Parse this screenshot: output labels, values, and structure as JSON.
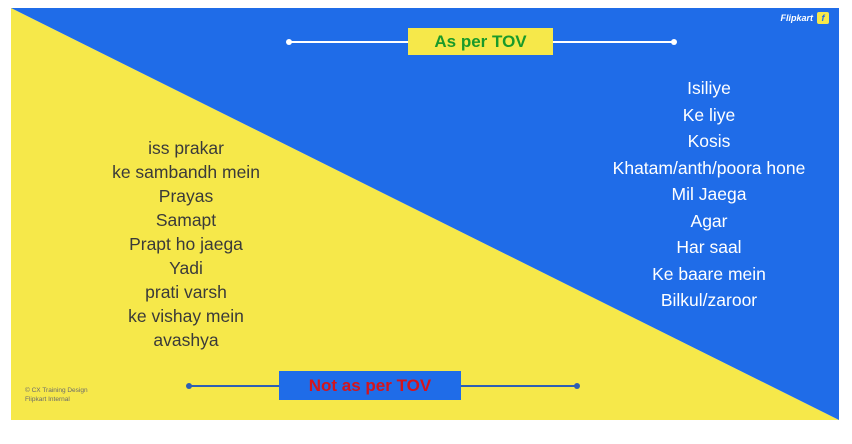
{
  "colors": {
    "blue": "#1f6ce8",
    "yellow": "#f6e84a",
    "green_text": "#1a9a2a",
    "red_text": "#d4141c"
  },
  "logo": {
    "text": "Flipkart",
    "icon": "flipkart-bag-icon",
    "glyph": "f"
  },
  "top_badge": {
    "label": "As per TOV"
  },
  "bottom_badge": {
    "label": "Not as per TOV"
  },
  "not_as_per_tov": [
    "iss prakar",
    "ke sambandh mein",
    "Prayas",
    "Samapt",
    "Prapt ho jaega",
    "Yadi",
    "prati varsh",
    "ke vishay mein",
    "avashya"
  ],
  "as_per_tov": [
    "Isiliye",
    "Ke liye",
    "Kosis",
    "Khatam/anth/poora hone",
    "Mil Jaega",
    "Agar",
    "Har saal",
    "Ke baare mein",
    "Bilkul/zaroor"
  ],
  "footer": {
    "line1": "© CX Training Design",
    "line2": "Flipkart Internal"
  }
}
